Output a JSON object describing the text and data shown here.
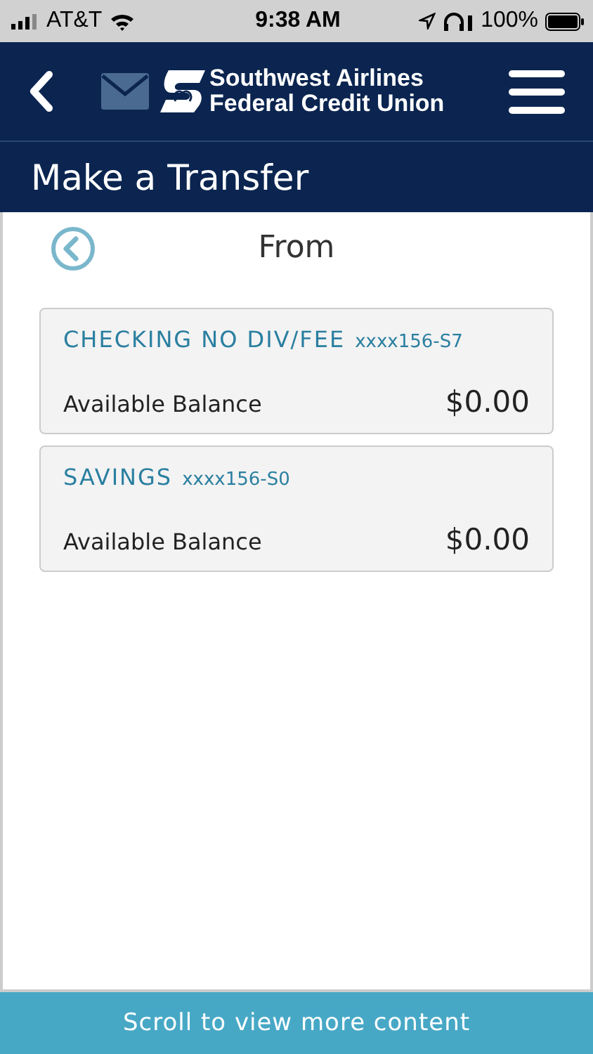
{
  "status_bar": {
    "carrier": "AT&T",
    "time": "9:38 AM",
    "battery": "100%"
  },
  "header": {
    "logo_line_1": "Southwest Airlines",
    "logo_line_2": "Federal Credit Union"
  },
  "page_title": "Make a Transfer",
  "section_title": "From",
  "accounts": [
    {
      "name": "CHECKING NO DIV/FEE",
      "number": "xxxx156-S7",
      "balance_label": "Available Balance",
      "balance": "$0.00"
    },
    {
      "name": "SAVINGS",
      "number": "xxxx156-S0",
      "balance_label": "Available Balance",
      "balance": "$0.00"
    }
  ],
  "footer": "Scroll to view more content"
}
